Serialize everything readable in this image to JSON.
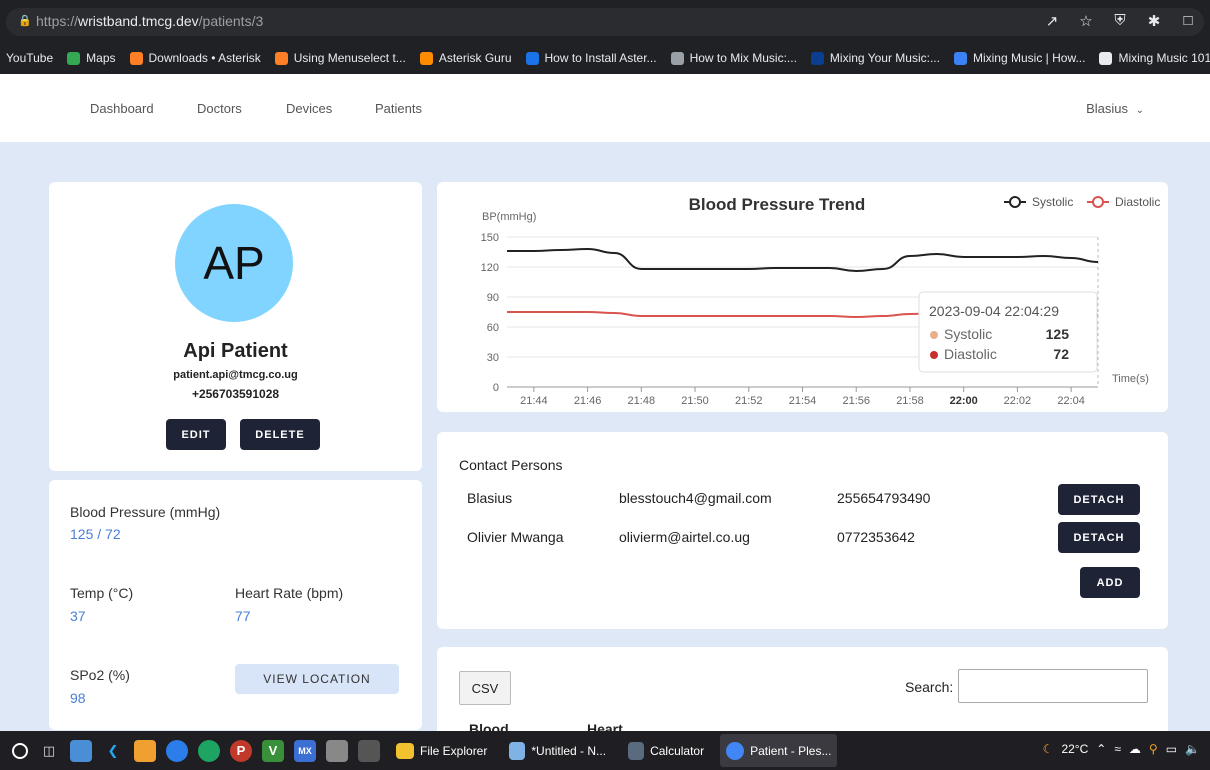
{
  "browser": {
    "url_prefix": "https://",
    "url_host": "wristband.tmcg.dev",
    "url_path": "/patients/3",
    "bookmarks": [
      {
        "label": "YouTube",
        "color": "#ff0000"
      },
      {
        "label": "Maps",
        "color": "#34a853"
      },
      {
        "label": "Downloads • Asterisk",
        "color": "#ff7f27"
      },
      {
        "label": "Using Menuselect t...",
        "color": "#ff7f27"
      },
      {
        "label": "Asterisk Guru",
        "color": "#ff8c00"
      },
      {
        "label": "How to Install Aster...",
        "color": "#1a73e8"
      },
      {
        "label": "How to Mix Music:...",
        "color": "#9aa0a6"
      },
      {
        "label": "Mixing Your Music:...",
        "color": "#0b3d91"
      },
      {
        "label": "Mixing Music | How...",
        "color": "#3b82f6"
      },
      {
        "label": "Mixing Music 101:...",
        "color": "#e8eaed"
      }
    ]
  },
  "nav": {
    "items": [
      "Dashboard",
      "Doctors",
      "Devices",
      "Patients"
    ],
    "user": "Blasius"
  },
  "profile": {
    "initials": "AP",
    "name": "Api Patient",
    "email": "patient.api@tmcg.co.ug",
    "phone": "+256703591028",
    "edit_label": "EDIT",
    "delete_label": "DELETE"
  },
  "vitals": {
    "bp_label": "Blood Pressure (mmHg)",
    "bp_value": "125 / 72",
    "temp_label": "Temp (°C)",
    "temp_value": "37",
    "hr_label": "Heart Rate (bpm)",
    "hr_value": "77",
    "spo2_label": "SPo2 (%)",
    "spo2_value": "98",
    "location_label": "VIEW LOCATION"
  },
  "chart_data": {
    "type": "line",
    "title": "Blood Pressure Trend",
    "ylabel": "BP(mmHg)",
    "xlabel": "Time(s)",
    "ylim": [
      0,
      150
    ],
    "yticks": [
      0,
      30,
      60,
      90,
      120,
      150
    ],
    "xticks": [
      "21:44",
      "21:46",
      "21:48",
      "21:50",
      "21:52",
      "21:54",
      "21:56",
      "21:58",
      "22:00",
      "22:02",
      "22:04"
    ],
    "x": [
      "21:43",
      "21:44",
      "21:45",
      "21:46",
      "21:47",
      "21:48",
      "21:49",
      "21:50",
      "21:51",
      "21:52",
      "21:53",
      "21:54",
      "21:55",
      "21:56",
      "21:57",
      "21:58",
      "21:59",
      "22:00",
      "22:01",
      "22:02",
      "22:03",
      "22:04",
      "22:05"
    ],
    "series": [
      {
        "name": "Systolic",
        "color": "#222222",
        "values": [
          136,
          136,
          137,
          138,
          134,
          118,
          118,
          118,
          118,
          118,
          119,
          119,
          119,
          116,
          118,
          131,
          133,
          130,
          130,
          130,
          131,
          129,
          125
        ]
      },
      {
        "name": "Diastolic",
        "color": "#d9534f",
        "values": [
          75,
          75,
          75,
          75,
          74,
          71,
          71,
          71,
          71,
          71,
          71,
          71,
          71,
          70,
          71,
          73,
          74,
          74,
          74,
          74,
          74,
          73,
          72
        ]
      }
    ],
    "legend": "top-right",
    "grid": true,
    "tooltip": {
      "time": "2023-09-04 22:04:29",
      "rows": [
        {
          "name": "Systolic",
          "value": "125",
          "color": "#e8b08a"
        },
        {
          "name": "Diastolic",
          "value": "72",
          "color": "#c9302c"
        }
      ]
    }
  },
  "contacts": {
    "title": "Contact Persons",
    "rows": [
      {
        "name": "Blasius",
        "email": "blesstouch4@gmail.com",
        "phone": "255654793490",
        "action": "DETACH"
      },
      {
        "name": "Olivier Mwanga",
        "email": "olivierm@airtel.co.ug",
        "phone": "0772353642",
        "action": "DETACH"
      }
    ],
    "add_label": "ADD"
  },
  "table": {
    "csv_label": "CSV",
    "search_label": "Search:",
    "headers": [
      "Blood",
      "Heart"
    ]
  },
  "taskbar": {
    "apps": [
      "File Explorer",
      "*Untitled - N...",
      "Calculator",
      "Patient - Ples..."
    ],
    "weather": "22°C"
  }
}
